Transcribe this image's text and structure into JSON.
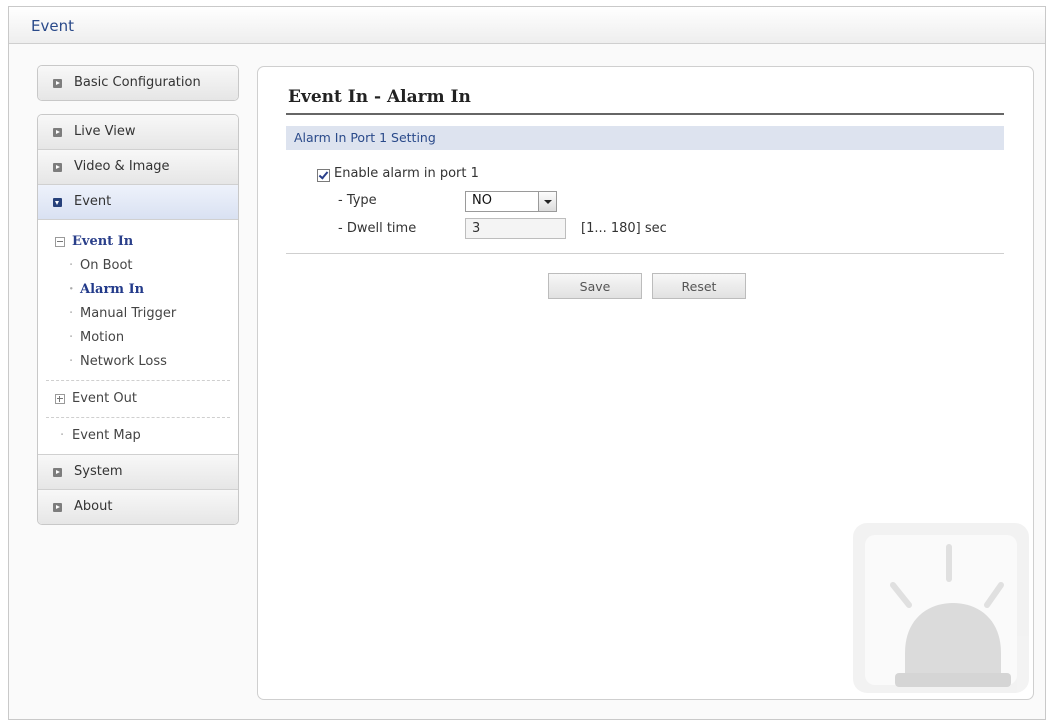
{
  "window": {
    "title": "Event"
  },
  "sidebar": {
    "basic_configuration": "Basic Configuration",
    "items": [
      {
        "label": "Live View"
      },
      {
        "label": "Video & Image"
      },
      {
        "label": "Event"
      }
    ],
    "event_submenu": {
      "event_in": "Event In",
      "event_in_items": [
        "On Boot",
        "Alarm In",
        "Manual Trigger",
        "Motion",
        "Network Loss"
      ],
      "event_out": "Event Out",
      "event_map": "Event Map"
    },
    "bottom_items": [
      {
        "label": "System"
      },
      {
        "label": "About"
      }
    ]
  },
  "main": {
    "title": "Event In - Alarm In",
    "section_title": "Alarm In Port 1 Setting",
    "enable_label": "Enable alarm in port 1",
    "enable_checked": true,
    "type_label": "- Type",
    "type_value": "NO",
    "dwell_label": "- Dwell time",
    "dwell_value": "3",
    "dwell_range": "[1... 180] sec",
    "save_label": "Save",
    "reset_label": "Reset"
  },
  "colors": {
    "accent": "#2a3f8a",
    "section_bg": "#dde3ef"
  }
}
